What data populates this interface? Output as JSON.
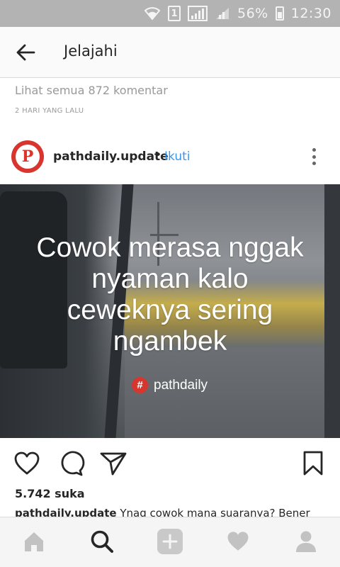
{
  "status_bar": {
    "sim_number": "1",
    "battery_percent": "56%",
    "time": "12:30"
  },
  "app_bar": {
    "back_icon": "arrow-left-icon",
    "title": "Jelajahi"
  },
  "comments": {
    "view_all": "Lihat semua 872 komentar",
    "time_ago": "2 HARI YANG LALU"
  },
  "post": {
    "username": "pathdaily.update",
    "separator": "•",
    "follow_label": "Ikuti",
    "avatar_letter": "P",
    "image": {
      "quote_lines": [
        "Cowok merasa nggak",
        "nyaman kalo",
        "ceweknya sering",
        "ngambek"
      ],
      "brand_hash": "#",
      "brand_name": "pathdaily"
    },
    "actions": {
      "like_icon": "heart-outline-icon",
      "comment_icon": "comment-bubble-icon",
      "share_icon": "send-icon",
      "save_icon": "bookmark-icon"
    },
    "likes": "5.742 suka",
    "caption_username": "pathdaily.update",
    "caption_text": " Ynag cowok mana suaranya? Bener"
  },
  "bottom_nav": {
    "items": [
      {
        "icon": "home-icon"
      },
      {
        "icon": "search-icon"
      },
      {
        "icon": "add-icon"
      },
      {
        "icon": "heart-icon"
      },
      {
        "icon": "profile-icon"
      }
    ]
  },
  "colors": {
    "accent_blue": "#3897f0",
    "brand_red": "#d7352e",
    "status_bar": "#b3b3b3"
  }
}
